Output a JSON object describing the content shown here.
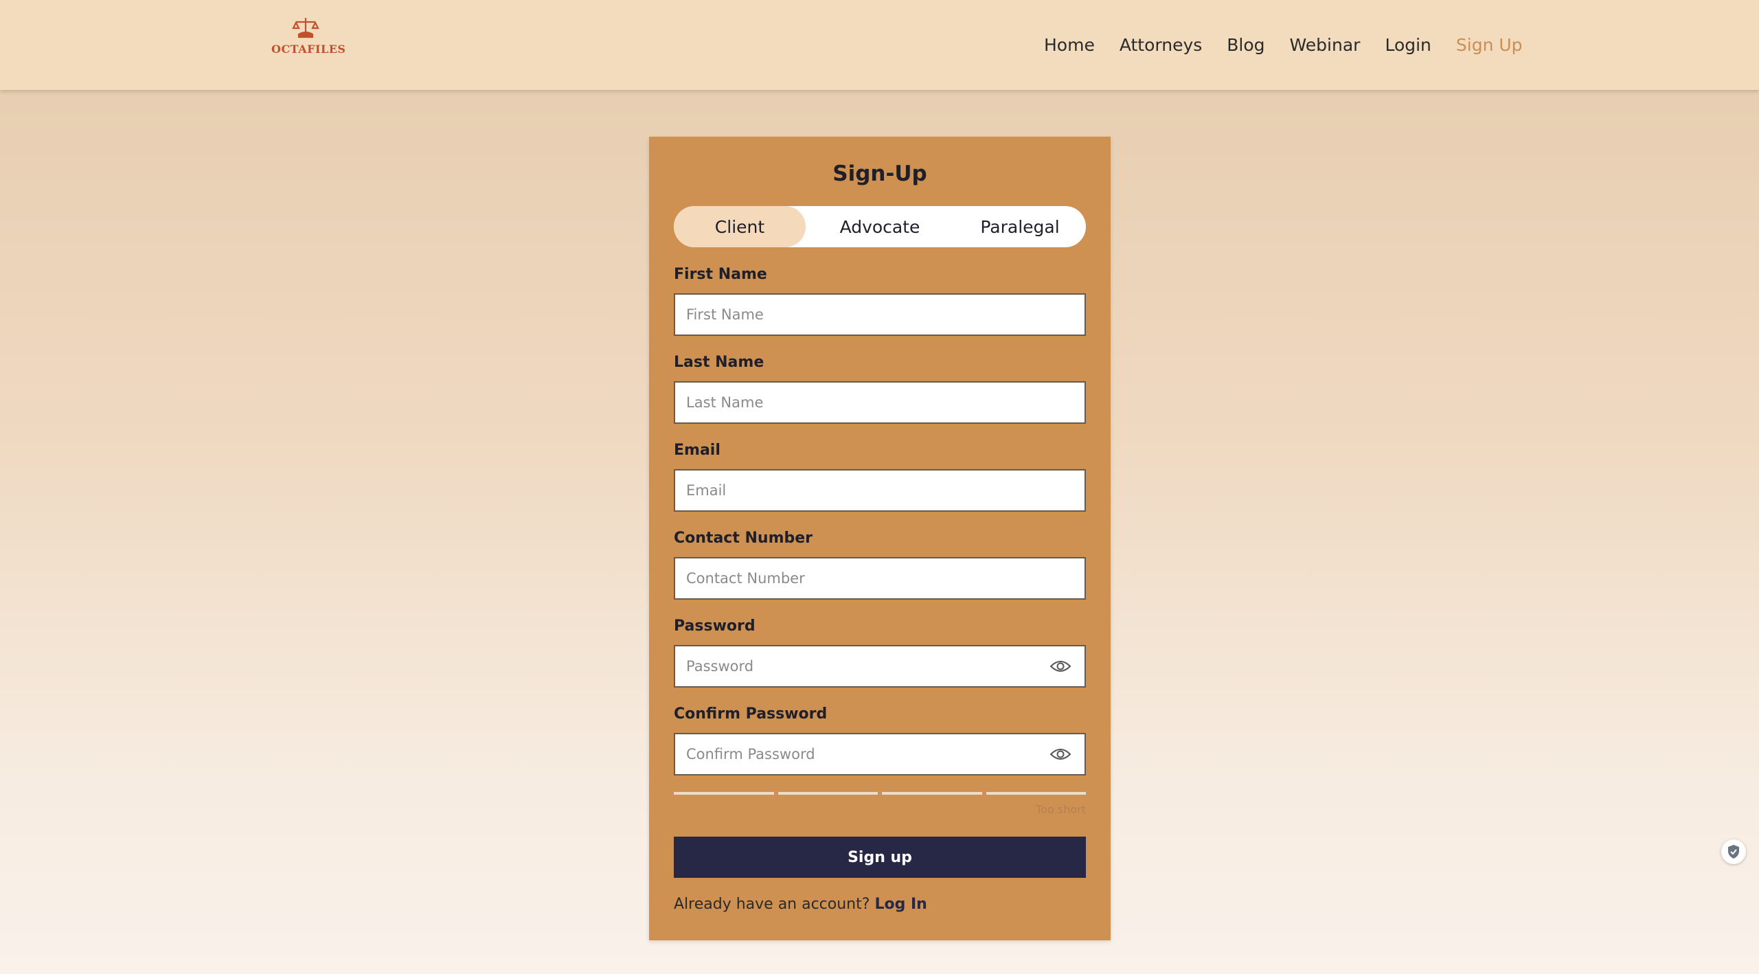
{
  "header": {
    "logo_text": "OCTAFILES",
    "nav": [
      {
        "label": "Home"
      },
      {
        "label": "Attorneys"
      },
      {
        "label": "Blog"
      },
      {
        "label": "Webinar"
      },
      {
        "label": "Login"
      },
      {
        "label": "Sign Up",
        "active": true
      }
    ]
  },
  "form": {
    "title": "Sign-Up",
    "tabs": [
      {
        "label": "Client",
        "selected": true
      },
      {
        "label": "Advocate"
      },
      {
        "label": "Paralegal"
      }
    ],
    "fields": [
      {
        "label": "First Name",
        "placeholder": "First Name",
        "value": ""
      },
      {
        "label": "Last Name",
        "placeholder": "Last Name",
        "value": ""
      },
      {
        "label": "Email",
        "placeholder": "Email",
        "value": ""
      },
      {
        "label": "Contact Number",
        "placeholder": "Contact Number",
        "value": ""
      },
      {
        "label": "Password",
        "placeholder": "Password",
        "value": "",
        "icon": "eye-icon"
      },
      {
        "label": "Confirm Password",
        "placeholder": "Confirm Password",
        "value": "",
        "icon": "eye-icon"
      }
    ],
    "strength_text": "Too short",
    "submit_label": "Sign up",
    "login_prompt": "Already have an account?",
    "login_link": "Log In"
  },
  "colors": {
    "header_bg": "#f3dbbe",
    "card_bg": "#cf9152",
    "active_nav": "#c98f55",
    "button_bg": "#262846",
    "selected_tab": "#f4d9bb",
    "logo": "#c4502a"
  },
  "icons": [
    "scales-icon",
    "eye-icon",
    "shield-icon"
  ]
}
